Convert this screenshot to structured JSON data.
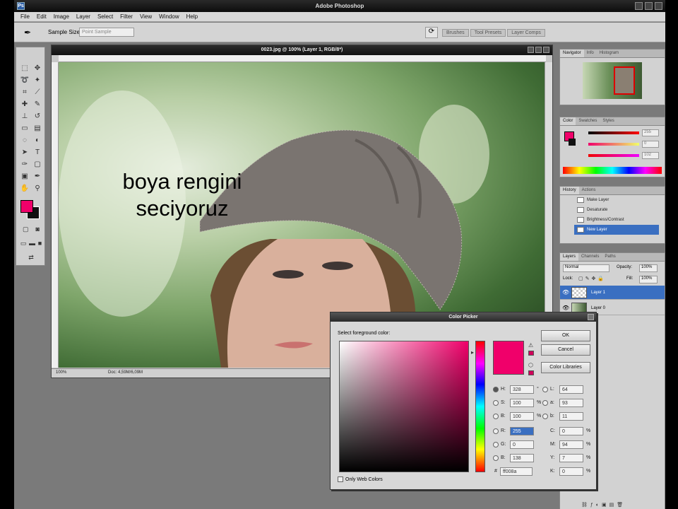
{
  "app_title": "Adobe Photoshop",
  "menu": [
    "File",
    "Edit",
    "Image",
    "Layer",
    "Select",
    "Filter",
    "View",
    "Window",
    "Help"
  ],
  "options": {
    "sample_size_label": "Sample Size:",
    "sample_size_value": "Point Sample",
    "wells": [
      "Brushes",
      "Tool Presets",
      "Layer Comps"
    ]
  },
  "document": {
    "title": "0023.jpg @ 100% (Layer 1, RGB/8*)",
    "zoom": "100%",
    "doc_size": "Doc: 4,59M/6,09M"
  },
  "overlay_text": {
    "line1": "boya rengini",
    "line2": "seciyoruz"
  },
  "panels": {
    "navigator_tabs": [
      "Navigator",
      "Info",
      "Histogram"
    ],
    "color_tabs": [
      "Color",
      "Swatches",
      "Styles"
    ],
    "color_values": [
      "255",
      "0",
      "102"
    ],
    "history_tabs": [
      "History",
      "Actions"
    ],
    "history_items": [
      "Make Layer",
      "Desaturate",
      "Brightness/Contrast",
      "New Layer"
    ],
    "layers_tabs": [
      "Layers",
      "Channels",
      "Paths"
    ],
    "blend_mode": "Normal",
    "opacity_label": "Opacity:",
    "opacity_value": "100%",
    "lock_label": "Lock:",
    "fill_label": "Fill:",
    "fill_value": "100%",
    "layers": [
      "Layer 1",
      "Layer 0"
    ]
  },
  "color_picker": {
    "title": "Color Picker",
    "prompt": "Select foreground color:",
    "buttons": [
      "OK",
      "Cancel",
      "Color Libraries"
    ],
    "hsb": [
      {
        "label": "H:",
        "value": "328",
        "unit": "°"
      },
      {
        "label": "S:",
        "value": "100",
        "unit": "%"
      },
      {
        "label": "B:",
        "value": "100",
        "unit": "%"
      }
    ],
    "rgb": [
      {
        "label": "R:",
        "value": "255"
      },
      {
        "label": "G:",
        "value": "0"
      },
      {
        "label": "B:",
        "value": "138"
      }
    ],
    "lab": [
      {
        "label": "L:",
        "value": "64"
      },
      {
        "label": "a:",
        "value": "93"
      },
      {
        "label": "b:",
        "value": "11"
      }
    ],
    "cmyk": [
      {
        "label": "C:",
        "value": "0",
        "unit": "%"
      },
      {
        "label": "M:",
        "value": "94",
        "unit": "%"
      },
      {
        "label": "Y:",
        "value": "7",
        "unit": "%"
      },
      {
        "label": "K:",
        "value": "0",
        "unit": "%"
      }
    ],
    "hex_label": "#",
    "hex_value": "ff008a",
    "only_web": "Only Web Colors"
  },
  "colors": {
    "foreground": "#f0006a",
    "selection": "#3a6fc1"
  }
}
